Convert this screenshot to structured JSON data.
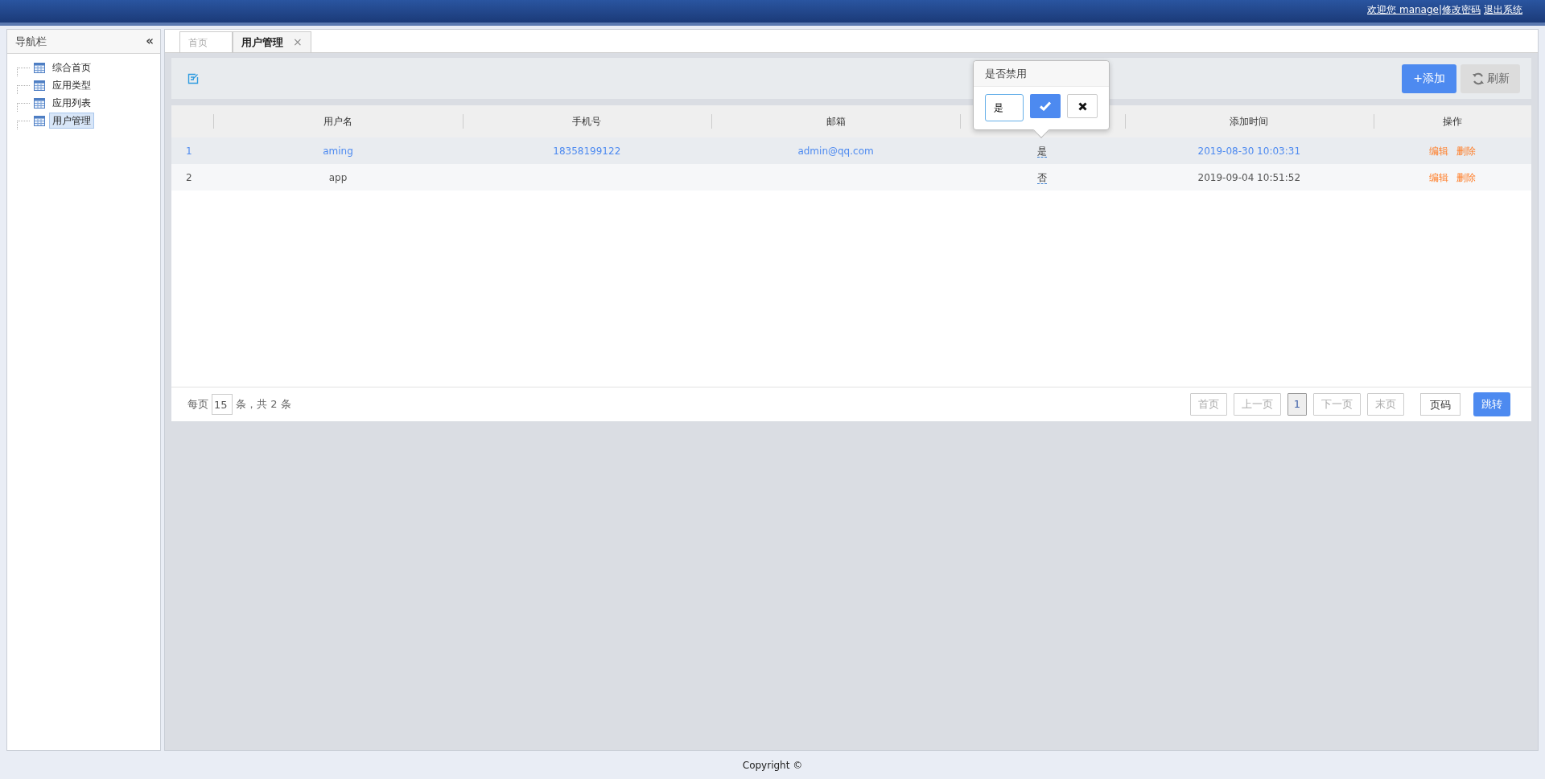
{
  "header": {
    "welcome": "欢迎您 manage",
    "separator": "|",
    "links": [
      "修改密码",
      "退出系统"
    ]
  },
  "sidebar": {
    "title": "导航栏",
    "collapse": "«",
    "items": [
      {
        "label": "综合首页",
        "selected": false
      },
      {
        "label": "应用类型",
        "selected": false
      },
      {
        "label": "应用列表",
        "selected": false
      },
      {
        "label": "用户管理",
        "selected": true
      }
    ]
  },
  "tabs": [
    {
      "label": "首页",
      "selected": false
    },
    {
      "label": "用户管理",
      "selected": true,
      "close": "×"
    }
  ],
  "toolbar": {
    "add": "+添加",
    "refresh": "刷新"
  },
  "popover": {
    "title": "是否禁用",
    "value": "是"
  },
  "table": {
    "columns": [
      {},
      {
        "label": "用户名"
      },
      {
        "label": "手机号"
      },
      {
        "label": "邮箱"
      },
      {},
      {
        "label": "添加时间"
      },
      {
        "label": "操作"
      }
    ],
    "rows": [
      {
        "number": "1",
        "username": "aming",
        "phone": "18358199122",
        "email": "admin@qq.com",
        "disabled": "是",
        "time": "2019-08-30 10:03:31",
        "actions": [
          "编辑",
          "删除"
        ],
        "selected": true
      },
      {
        "number": "2",
        "username": "app",
        "disabled": "否",
        "time": "2019-09-04 10:51:52",
        "actions": [
          "编辑",
          "删除"
        ],
        "selected": false
      }
    ]
  },
  "pager": {
    "per_page_label": "每页",
    "per_page": "15",
    "total": "条，共 2 条",
    "buttons": [
      {
        "kind": "nav",
        "label": "首页",
        "disabled": true,
        "selected": false
      },
      {
        "kind": "nav",
        "label": "上一页",
        "disabled": true,
        "selected": false
      },
      {
        "kind": "page",
        "label": "1",
        "disabled": false,
        "selected": true
      },
      {
        "kind": "nav",
        "label": "下一页",
        "disabled": true,
        "selected": false
      },
      {
        "kind": "nav",
        "label": "末页",
        "disabled": true,
        "selected": false
      }
    ],
    "jump_placeholder": "页码",
    "jump_button": "跳转"
  },
  "footer": "Copyright ©"
}
